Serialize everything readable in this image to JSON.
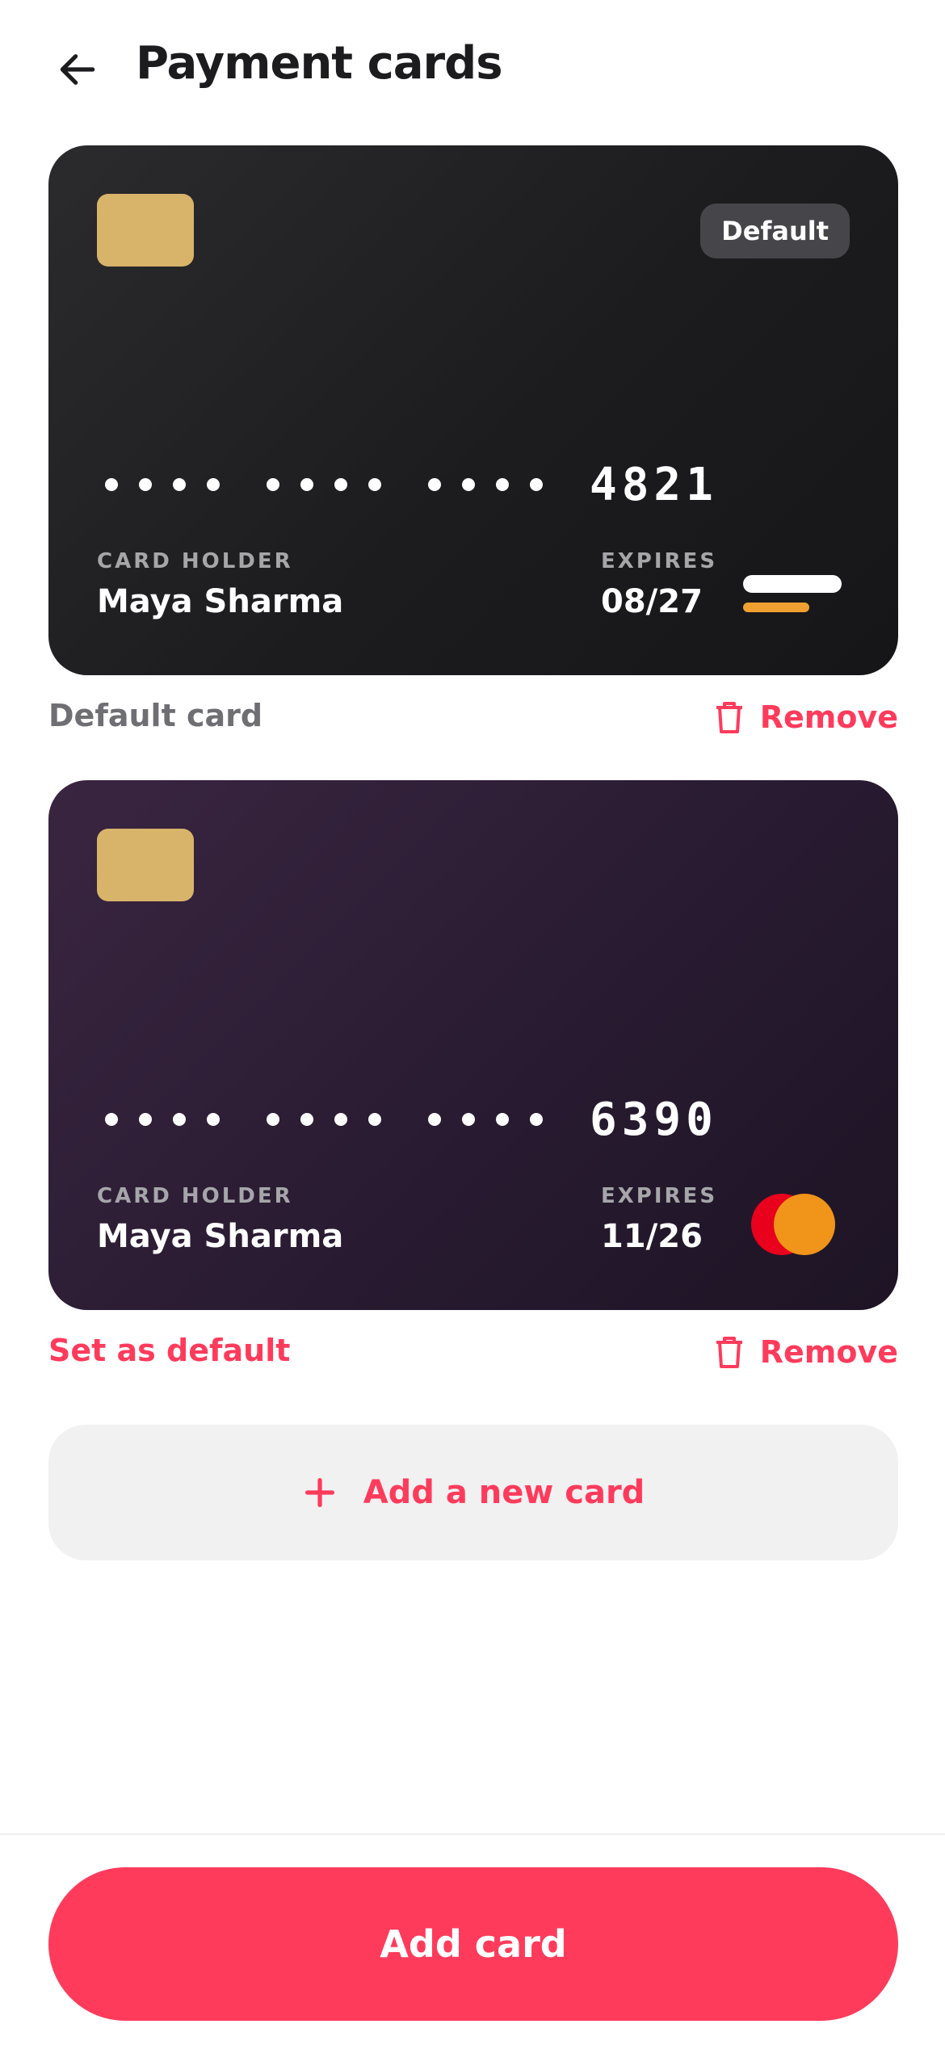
{
  "header": {
    "title": "Payment cards",
    "back_icon": "arrow-left-icon"
  },
  "cards": [
    {
      "badge": "Default",
      "masked_groups": [
        "••••",
        "••••",
        "••••"
      ],
      "last4": "4821",
      "holder_label": "CARD HOLDER",
      "holder_name": "Maya Sharma",
      "expires_label": "EXPIRES",
      "expires": "08/27",
      "brand_icon": "card-brand-bars-icon",
      "status_text": "Default card",
      "remove_label": "Remove"
    },
    {
      "masked_groups": [
        "••••",
        "••••",
        "••••"
      ],
      "last4": "6390",
      "holder_label": "CARD HOLDER",
      "holder_name": "Maya Sharma",
      "expires_label": "EXPIRES",
      "expires": "11/26",
      "brand_icon": "mastercard-logo-icon",
      "action_text": "Set as default",
      "remove_label": "Remove"
    }
  ],
  "add_new_card": {
    "label": "Add a new card",
    "icon": "plus-icon"
  },
  "primary_button": {
    "label": "Add card"
  },
  "colors": {
    "accent": "#ff3b5c",
    "card1_bg": "#1c1c1e",
    "card2_bg": "#2a1c33",
    "chip": "#d8b46a",
    "mastercard_red": "#e8001c",
    "mastercard_orange": "#f0941a"
  }
}
